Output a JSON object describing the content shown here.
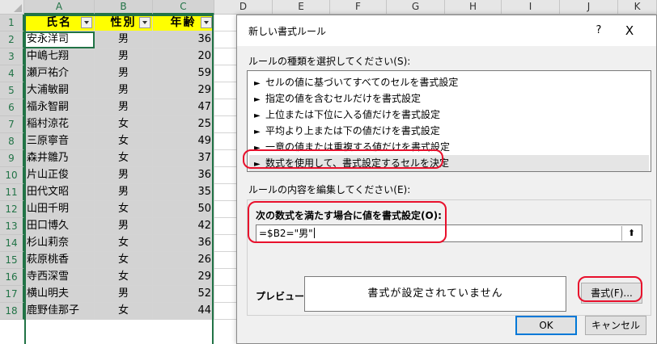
{
  "sheet": {
    "columns": [
      "A",
      "B",
      "C",
      "D",
      "E",
      "F",
      "G",
      "H",
      "I",
      "J",
      "K"
    ],
    "headers": {
      "name": "氏名",
      "gender": "性別",
      "age": "年齢"
    },
    "rows": [
      {
        "row": "1",
        "name": "",
        "gender": "",
        "age": ""
      },
      {
        "row": "2",
        "name": "安永洋司",
        "gender": "男",
        "age": "36"
      },
      {
        "row": "3",
        "name": "中嶋七翔",
        "gender": "男",
        "age": "20"
      },
      {
        "row": "4",
        "name": "瀬戸祐介",
        "gender": "男",
        "age": "59"
      },
      {
        "row": "5",
        "name": "大浦敏嗣",
        "gender": "男",
        "age": "29"
      },
      {
        "row": "6",
        "name": "福永智嗣",
        "gender": "男",
        "age": "47"
      },
      {
        "row": "7",
        "name": "稲村涼花",
        "gender": "女",
        "age": "25"
      },
      {
        "row": "8",
        "name": "三原寧音",
        "gender": "女",
        "age": "49"
      },
      {
        "row": "9",
        "name": "森井雛乃",
        "gender": "女",
        "age": "37"
      },
      {
        "row": "10",
        "name": "片山正俊",
        "gender": "男",
        "age": "36"
      },
      {
        "row": "11",
        "name": "田代文昭",
        "gender": "男",
        "age": "35"
      },
      {
        "row": "12",
        "name": "山田千明",
        "gender": "女",
        "age": "50"
      },
      {
        "row": "13",
        "name": "田口博久",
        "gender": "男",
        "age": "42"
      },
      {
        "row": "14",
        "name": "杉山莉奈",
        "gender": "女",
        "age": "36"
      },
      {
        "row": "15",
        "name": "萩原桃香",
        "gender": "女",
        "age": "26"
      },
      {
        "row": "16",
        "name": "寺西深雪",
        "gender": "女",
        "age": "29"
      },
      {
        "row": "17",
        "name": "横山明夫",
        "gender": "男",
        "age": "52"
      },
      {
        "row": "18",
        "name": "鹿野佳那子",
        "gender": "女",
        "age": "44"
      }
    ]
  },
  "dialog": {
    "title": "新しい書式ルール",
    "help": "?",
    "close": "X",
    "rule_type_label": "ルールの種類を選択してください(S):",
    "rule_types": [
      "セルの値に基づいてすべてのセルを書式設定",
      "指定の値を含むセルだけを書式設定",
      "上位または下位に入る値だけを書式設定",
      "平均より上または下の値だけを書式設定",
      "一意の値または重複する値だけを書式設定",
      "数式を使用して、書式設定するセルを決定"
    ],
    "rule_arrow": "►",
    "edit_label": "ルールの内容を編集してください(E):",
    "formula_label": "次の数式を満たす場合に値を書式設定(O):",
    "formula_value": "=$B2=\"男\"",
    "collapse_icon": "⬆",
    "preview_label": "プレビュー:",
    "preview_text": "書式が設定されていません",
    "format_button": "書式(F)...",
    "ok_button": "OK",
    "cancel_button": "キャンセル"
  },
  "colors": {
    "excel_green": "#217346",
    "highlight_red": "#e8102c",
    "header_yellow": "#ffff00"
  }
}
